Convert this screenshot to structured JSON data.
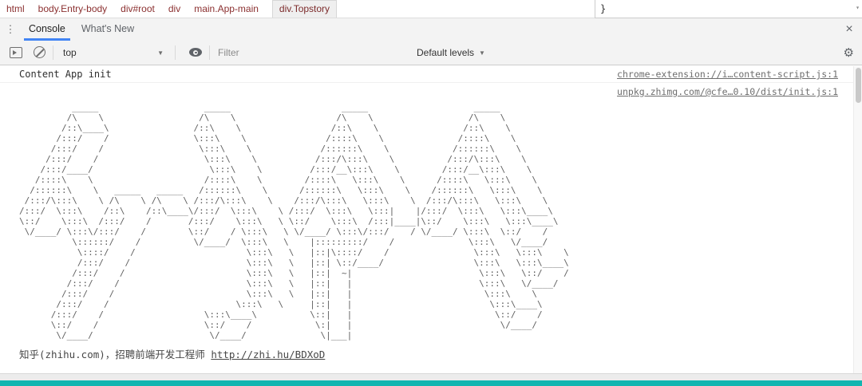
{
  "breadcrumb": {
    "items": [
      "html",
      "body.Entry-body",
      "div#root",
      "div",
      "main.App-main",
      "div.Topstory"
    ]
  },
  "styles_pane": {
    "brace": "}",
    "scroll_caret": "▾"
  },
  "tab_bar": {
    "kebab": "⋮",
    "tabs": [
      {
        "label": "Console"
      },
      {
        "label": "What's New"
      }
    ],
    "close": "×"
  },
  "toolbar": {
    "context": "top",
    "caret": "▼",
    "filter_placeholder": "Filter",
    "levels": "Default levels",
    "gear": "⚙"
  },
  "console": {
    "row1": {
      "message": "Content App init",
      "source": "chrome-extension://i…content-script.js:1"
    },
    "row2": {
      "source": "unpkg.zhimg.com/@cfe…0.10/dist/init.js:1",
      "ascii_art_lines": [
        "          _____                    _____                     _____                    _____",
        "         /\\    \\                  /\\    \\                   /\\    \\                  /\\    \\",
        "        /::\\____\\                /::\\    \\                 /::\\    \\                /::\\    \\",
        "       /:::/    /                \\:::\\    \\               /::::\\    \\              /::::\\    \\",
        "      /:::/    /                  \\:::\\    \\             /::::::\\    \\            /::::::\\    \\",
        "     /:::/    /                    \\:::\\    \\           /:::/\\:::\\    \\          /:::/\\:::\\    \\",
        "    /:::/____/                      \\:::\\    \\         /:::/__\\:::\\    \\        /:::/__\\:::\\    \\",
        "   /::::\\    \\                     /::::\\    \\        /::::\\   \\:::\\    \\      /::::\\   \\:::\\    \\",
        "  /::::::\\    \\   _____   _____   /::::::\\    \\      /::::::\\   \\:::\\    \\    /::::::\\   \\:::\\    \\",
        " /:::/\\:::\\    \\ /\\    \\ /\\    \\ /:::/\\:::\\    \\    /:::/\\:::\\   \\:::\\    \\  /:::/\\:::\\   \\:::\\    \\",
        "/:::/  \\:::\\    /::\\    /::\\____\\/:::/  \\:::\\    \\ /:::/  \\:::\\   \\:::|    |/:::/  \\:::\\   \\:::\\____\\",
        "\\::/    \\:::\\  /:::/    /       /:::/    \\:::\\   \\ \\::/    \\:::\\  /:::|____|\\::/    \\:::\\   \\:::\\____\\",
        " \\/____/ \\:::\\/:::/    /        \\::/    / \\:::\\   \\ \\/____/ \\:::\\/:::/    / \\/____/ \\:::\\  \\::/    /",
        "          \\::::::/    /          \\/____/  \\:::\\   \\    |:::::::::/    /              \\:::\\   \\/____/",
        "           \\::::/    /                     \\:::\\   \\   |::|\\::::/    /                \\:::\\   \\:::\\    \\",
        "           /:::/    /                      \\:::\\   \\   |::| \\::/____/                 \\:::\\   \\:::\\____\\",
        "          /:::/    /                       \\:::\\   \\   |::|  ~|                        \\:::\\   \\::/    /",
        "         /:::/    /                        \\:::\\   \\   |::|   |                        \\:::\\   \\/____/",
        "        /:::/    /                         \\:::\\   \\   |::|   |                         \\:::\\    \\",
        "       /:::/    /                        \\:::\\   \\     |::|   |                          \\:::\\____\\",
        "      /:::/    /                   \\:::\\____\\          \\::|   |                           \\::/    /",
        "      \\::/    /                    \\::/    /            \\:|   |                            \\/____/",
        "       \\/____/                      \\/____/              \\|___|"
      ],
      "footer_text": "知乎(zhihu.com)，招聘前端开发工程师 ",
      "footer_link": "http://zhi.hu/BDXoD"
    }
  },
  "colors": {
    "accent_blue": "#4285f4",
    "teal_bar": "#12b5b0",
    "breadcrumb_text": "#8b3030",
    "link_gray": "#6e6e6e"
  }
}
